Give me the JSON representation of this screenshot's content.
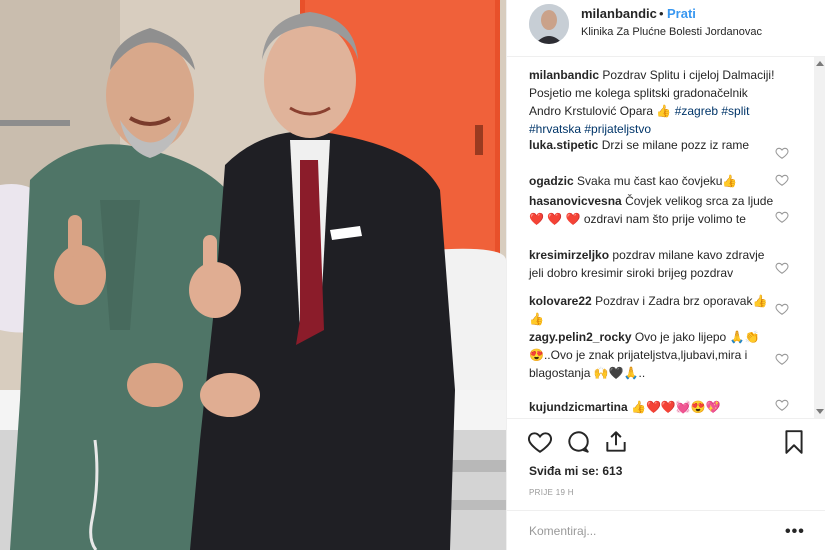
{
  "header": {
    "username": "milanbandic",
    "separator": "•",
    "follow_label": "Prati",
    "location": "Klinika Za Plućne Bolesti Jordanovac"
  },
  "caption": {
    "username": "milanbandic",
    "text": "Pozdrav Splitu i cijeloj Dalmaciji! Posjetio me kolega splitski gradonačelnik Andro Krstulović Opara 👍",
    "hashtags": "#zagreb #split #hrvatska #prijateljstvo"
  },
  "comments": [
    {
      "username": "luka.stipetic",
      "text": "Drzi se milane pozz iz rame"
    },
    {
      "username": "ogadzic",
      "text": "Svaka mu čast kao čovjeku👍"
    },
    {
      "username": "hasanovicvesna",
      "text": "Čovjek velikog srca za ljude❤️ ❤️ ❤️ ozdravi nam što prije volimo te"
    },
    {
      "username": "kresimirzeljko",
      "text": "pozdrav milane kavo zdravje jeli dobro kresimir siroki brijeg pozdrav"
    },
    {
      "username": "kolovare22",
      "text": "Pozdrav i Zadra brz oporavak👍👍"
    },
    {
      "username": "zagy.pelin2_rocky",
      "text": "Ovo je jako lijepo 🙏👏😍..Ovo je znak prijateljstva,ljubavi,mira i blagostanja 🙌🖤🙏.."
    },
    {
      "username": "kujundzicmartina",
      "text": "👍❤️❤️💓😍💖"
    }
  ],
  "actions": {
    "likes_label": "Sviđa mi se:",
    "likes_count": "613",
    "time_ago": "PRIJE 19 H"
  },
  "add_comment": {
    "placeholder": "Komentiraj...",
    "more_label": "•••"
  },
  "colors": {
    "follow_blue": "#3897f0",
    "hashtag": "#003569",
    "muted": "#999999"
  },
  "icons": [
    "heart-icon",
    "comment-icon",
    "share-icon",
    "bookmark-icon"
  ]
}
